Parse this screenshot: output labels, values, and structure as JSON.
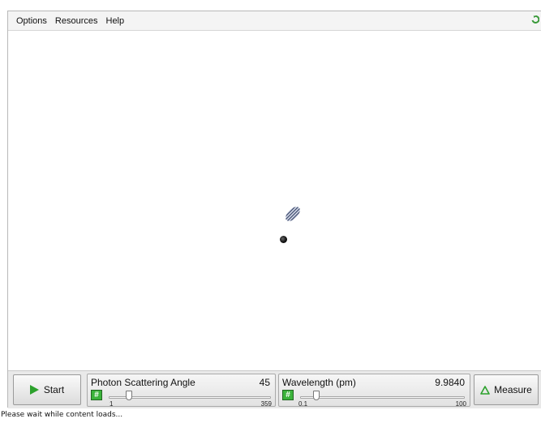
{
  "menu": {
    "items": [
      "Options",
      "Resources",
      "Help"
    ]
  },
  "icons": {
    "refresh": "refresh-icon",
    "photon": "photon-icon",
    "electron": "electron-dot",
    "play": "play-icon",
    "hash": "number-input-icon",
    "measure": "triangle-icon"
  },
  "controls": {
    "start_label": "Start",
    "measure_label": "Measure",
    "angle": {
      "title": "Photon Scattering Angle",
      "value": "45",
      "min": "1",
      "max": "359",
      "position_fraction": 0.123
    },
    "wavelength": {
      "title": "Wavelength (pm)",
      "value": "9.9840",
      "min": "0.1",
      "max": "100",
      "position_fraction": 0.099
    },
    "hash_symbol": "#"
  },
  "status": {
    "text": "Please wait while content loads..."
  },
  "colors": {
    "accent_green": "#2ca12c",
    "panel_bg": "#e9e9e9"
  }
}
